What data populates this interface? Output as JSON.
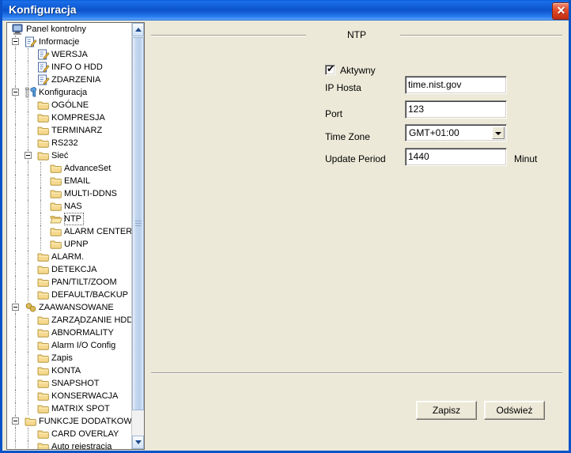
{
  "window": {
    "title": "Konfiguracja",
    "close_label": "✕"
  },
  "tree": {
    "items": [
      {
        "label": "Panel kontrolny",
        "depth": 0,
        "icon": "computer-icon",
        "expander": "none"
      },
      {
        "label": "Informacje",
        "depth": 1,
        "icon": "note-edit-icon",
        "expander": "minus"
      },
      {
        "label": "WERSJA",
        "depth": 2,
        "icon": "note-edit-icon",
        "expander": "none"
      },
      {
        "label": "INFO O HDD",
        "depth": 2,
        "icon": "note-edit-icon",
        "expander": "none"
      },
      {
        "label": "ZDARZENIA",
        "depth": 2,
        "icon": "note-edit-icon",
        "expander": "none"
      },
      {
        "label": "Konfiguracja",
        "depth": 1,
        "icon": "tools-icon",
        "expander": "minus"
      },
      {
        "label": "OGÓLNE",
        "depth": 2,
        "icon": "folder-icon",
        "expander": "none"
      },
      {
        "label": "KOMPRESJA",
        "depth": 2,
        "icon": "folder-icon",
        "expander": "none"
      },
      {
        "label": "TERMINARZ",
        "depth": 2,
        "icon": "folder-icon",
        "expander": "none"
      },
      {
        "label": "RS232",
        "depth": 2,
        "icon": "folder-icon",
        "expander": "none"
      },
      {
        "label": "Sieć",
        "depth": 2,
        "icon": "folder-icon",
        "expander": "minus"
      },
      {
        "label": "AdvanceSet",
        "depth": 3,
        "icon": "folder-icon",
        "expander": "none"
      },
      {
        "label": "EMAIL",
        "depth": 3,
        "icon": "folder-icon",
        "expander": "none"
      },
      {
        "label": "MULTI-DDNS",
        "depth": 3,
        "icon": "folder-icon",
        "expander": "none"
      },
      {
        "label": "NAS",
        "depth": 3,
        "icon": "folder-icon",
        "expander": "none"
      },
      {
        "label": "NTP",
        "depth": 3,
        "icon": "folder-open-icon",
        "expander": "none",
        "selected": true
      },
      {
        "label": "ALARM CENTER",
        "depth": 3,
        "icon": "folder-icon",
        "expander": "none"
      },
      {
        "label": "UPNP",
        "depth": 3,
        "icon": "folder-icon",
        "expander": "none"
      },
      {
        "label": "ALARM.",
        "depth": 2,
        "icon": "folder-icon",
        "expander": "none"
      },
      {
        "label": "DETEKCJA",
        "depth": 2,
        "icon": "folder-icon",
        "expander": "none"
      },
      {
        "label": "PAN/TILT/ZOOM",
        "depth": 2,
        "icon": "folder-icon",
        "expander": "none"
      },
      {
        "label": "DEFAULT/BACKUP",
        "depth": 2,
        "icon": "folder-icon",
        "expander": "none"
      },
      {
        "label": "ZAAWANSOWANE",
        "depth": 1,
        "icon": "gears-icon",
        "expander": "minus"
      },
      {
        "label": "ZARZĄDZANIE HDD",
        "depth": 2,
        "icon": "folder-icon",
        "expander": "none"
      },
      {
        "label": "ABNORMALITY",
        "depth": 2,
        "icon": "folder-icon",
        "expander": "none"
      },
      {
        "label": "Alarm I/O Config",
        "depth": 2,
        "icon": "folder-icon",
        "expander": "none"
      },
      {
        "label": "Zapis",
        "depth": 2,
        "icon": "folder-icon",
        "expander": "none"
      },
      {
        "label": "KONTA",
        "depth": 2,
        "icon": "folder-icon",
        "expander": "none"
      },
      {
        "label": "SNAPSHOT",
        "depth": 2,
        "icon": "folder-icon",
        "expander": "none"
      },
      {
        "label": "KONSERWACJA",
        "depth": 2,
        "icon": "folder-icon",
        "expander": "none"
      },
      {
        "label": "MATRIX SPOT",
        "depth": 2,
        "icon": "folder-icon",
        "expander": "none"
      },
      {
        "label": "FUNKCJE DODATKOWE",
        "depth": 1,
        "icon": "folder-icon",
        "expander": "minus"
      },
      {
        "label": "CARD OVERLAY",
        "depth": 2,
        "icon": "folder-icon",
        "expander": "none"
      },
      {
        "label": "Auto rejestracja",
        "depth": 2,
        "icon": "folder-icon",
        "expander": "none"
      }
    ]
  },
  "panel": {
    "group_title": "NTP",
    "active": {
      "label": "Aktywny",
      "checked": true,
      "tick": "✔"
    },
    "fields": {
      "host": {
        "label": "IP Hosta",
        "value": "time.nist.gov"
      },
      "port": {
        "label": "Port",
        "value": "123"
      },
      "timezone": {
        "label": "Time Zone",
        "value": "GMT+01:00"
      },
      "update_period": {
        "label": "Update Period",
        "value": "1440",
        "unit": "Minut"
      }
    },
    "buttons": {
      "save": "Zapisz",
      "refresh": "Odśwież"
    }
  }
}
